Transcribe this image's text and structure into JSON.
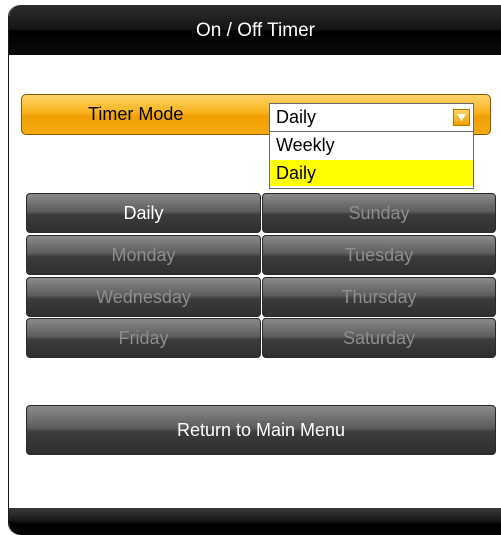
{
  "header": {
    "title": "On / Off Timer"
  },
  "timer_mode": {
    "label": "Timer Mode",
    "selected": "Daily",
    "options": [
      {
        "label": "Weekly",
        "selected": false
      },
      {
        "label": "Daily",
        "selected": true
      }
    ]
  },
  "days": [
    {
      "label": "Daily",
      "enabled": true
    },
    {
      "label": "Sunday",
      "enabled": false
    },
    {
      "label": "Monday",
      "enabled": false
    },
    {
      "label": "Tuesday",
      "enabled": false
    },
    {
      "label": "Wednesday",
      "enabled": false
    },
    {
      "label": "Thursday",
      "enabled": false
    },
    {
      "label": "Friday",
      "enabled": false
    },
    {
      "label": "Saturday",
      "enabled": false
    }
  ],
  "actions": {
    "return_label": "Return to Main Menu"
  },
  "colors": {
    "accent": "#f9b21c",
    "selected_option": "#ffff00",
    "enabled_text": "#ffffff",
    "disabled_text": "#8e8e8e"
  }
}
